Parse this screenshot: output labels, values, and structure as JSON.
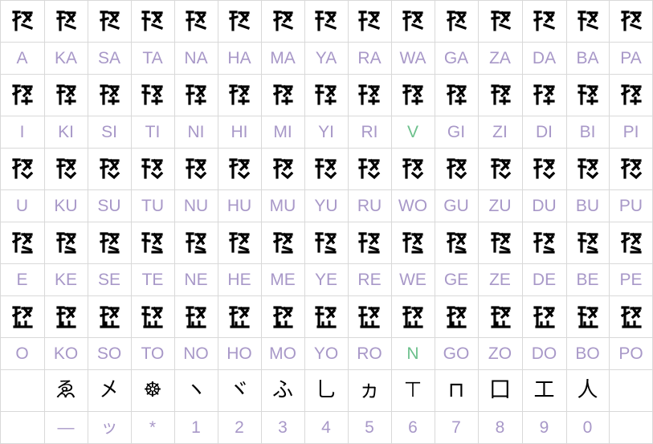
{
  "colors": {
    "label": "#a898c8",
    "highlight": "#6cc08c",
    "grid": "#d9d9d9",
    "glyph": "#000000"
  },
  "rows": [
    [
      "A",
      "KA",
      "SA",
      "TA",
      "NA",
      "HA",
      "MA",
      "YA",
      "RA",
      "WA",
      "GA",
      "ZA",
      "DA",
      "BA",
      "PA"
    ],
    [
      "I",
      "KI",
      "SI",
      "TI",
      "NI",
      "HI",
      "MI",
      "YI",
      "RI",
      "V",
      "GI",
      "ZI",
      "DI",
      "BI",
      "PI"
    ],
    [
      "U",
      "KU",
      "SU",
      "TU",
      "NU",
      "HU",
      "MU",
      "YU",
      "RU",
      "WO",
      "GU",
      "ZU",
      "DU",
      "BU",
      "PU"
    ],
    [
      "E",
      "KE",
      "SE",
      "TE",
      "NE",
      "HE",
      "ME",
      "YE",
      "RE",
      "WE",
      "GE",
      "ZE",
      "DE",
      "BE",
      "PE"
    ],
    [
      "O",
      "KO",
      "SO",
      "TO",
      "NO",
      "HO",
      "MO",
      "YO",
      "RO",
      "N",
      "GO",
      "ZO",
      "DO",
      "BO",
      "PO"
    ],
    [
      "",
      "—",
      "ッ",
      "*",
      "1",
      "2",
      "3",
      "4",
      "5",
      "6",
      "7",
      "8",
      "9",
      "0",
      ""
    ]
  ],
  "highlighted": [
    "V",
    "N"
  ],
  "symbol_glyphs": [
    "",
    "ゑ",
    "㐅",
    "☸",
    "ヽ",
    "ヾ",
    "ふ",
    "⺃",
    "ヵ",
    "⊤",
    "⊓",
    "⼞",
    "⼯",
    "人",
    ""
  ]
}
